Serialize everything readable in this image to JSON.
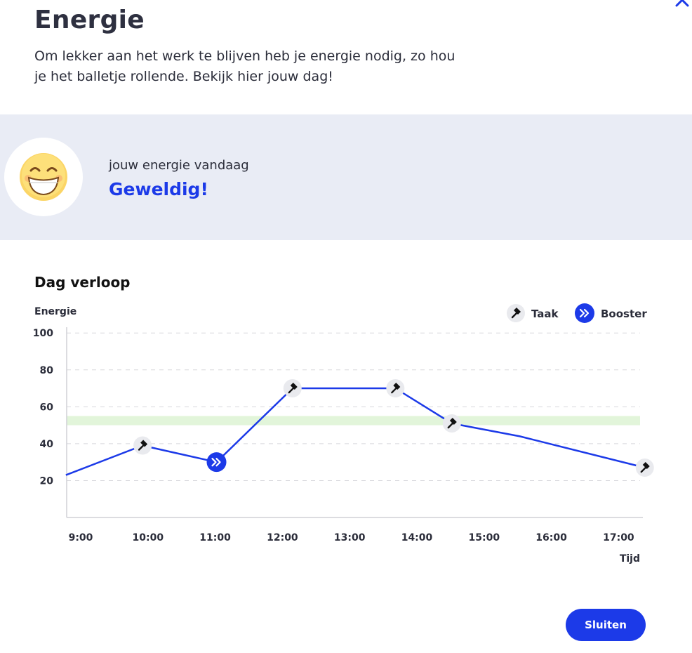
{
  "header": {
    "title": "Energie",
    "intro": "Om lekker aan het werk te blijven heb je energie nodig, zo hou je het balletje rollende. Bekijk hier jouw dag!"
  },
  "energy_today": {
    "label": "jouw energie vandaag",
    "value": "Geweldig!",
    "icon": "grinning-face-icon"
  },
  "colors": {
    "accent": "#1c3ae8",
    "target_band": "#e2f5da",
    "band_background": "#e9ecf5"
  },
  "chart_data": {
    "type": "line",
    "title": "Dag verloop",
    "xlabel": "Tijd",
    "ylabel": "Energie",
    "x_ticks": [
      "9:00",
      "10:00",
      "11:00",
      "12:00",
      "13:00",
      "14:00",
      "15:00",
      "16:00",
      "17:00"
    ],
    "y_ticks": [
      20,
      40,
      60,
      80,
      100
    ],
    "ylim": [
      0,
      100
    ],
    "xlim": [
      8.8,
      17.4
    ],
    "grid": "horizontal-dashed",
    "legend_position": "top-right",
    "target_band": [
      50,
      55
    ],
    "legend": [
      {
        "label": "Taak",
        "icon": "hammer-icon"
      },
      {
        "label": "Booster",
        "icon": "double-chevron-icon"
      }
    ],
    "series": [
      {
        "points": [
          {
            "time": "8:47",
            "x": 8.78,
            "y": 23
          },
          {
            "time": "9:55",
            "x": 9.92,
            "y": 39,
            "marker": "Taak"
          },
          {
            "time": "11:01",
            "x": 11.02,
            "y": 30,
            "marker": "Booster"
          },
          {
            "time": "12:09",
            "x": 12.15,
            "y": 70,
            "marker": "Taak"
          },
          {
            "time": "13:40",
            "x": 13.68,
            "y": 70,
            "marker": "Taak"
          },
          {
            "time": "14:31",
            "x": 14.52,
            "y": 51,
            "marker": "Taak"
          },
          {
            "time": "15:32",
            "x": 15.53,
            "y": 44
          },
          {
            "time": "17:23",
            "x": 17.39,
            "y": 27,
            "marker": "Taak"
          }
        ]
      }
    ]
  },
  "footer": {
    "close_label": "Sluiten"
  }
}
